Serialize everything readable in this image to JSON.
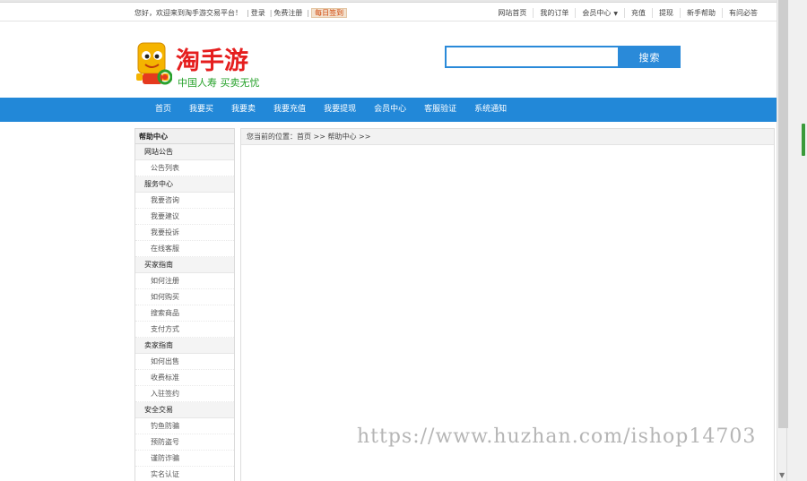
{
  "topbar": {
    "greeting": "您好，欢迎来到淘手游交易平台！",
    "login": "登录",
    "register": "免费注册",
    "signin": "每日签到",
    "links": [
      {
        "label": "网站首页",
        "style": ""
      },
      {
        "label": "我的订单",
        "style": ""
      },
      {
        "label": "会员中心",
        "style": "",
        "dropdown": true
      },
      {
        "label": "充值",
        "style": "orange"
      },
      {
        "label": "提现",
        "style": "green"
      },
      {
        "label": "新手帮助",
        "style": ""
      },
      {
        "label": "有问必答",
        "style": "red"
      }
    ]
  },
  "logo": {
    "name": "淘手游",
    "slogan": "中国人寿 买卖无忧"
  },
  "search": {
    "value": "",
    "placeholder": "",
    "button": "搜索"
  },
  "nav": [
    "首页",
    "我要买",
    "我要卖",
    "我要充值",
    "我要提现",
    "会员中心",
    "客服验证",
    "系统通知"
  ],
  "sidebar": {
    "title": "帮助中心",
    "groups": [
      {
        "name": "网站公告",
        "items": [
          "公告列表"
        ]
      },
      {
        "name": "服务中心",
        "items": [
          "我要咨询",
          "我要建议",
          "我要投诉",
          "在线客服"
        ]
      },
      {
        "name": "买家指南",
        "items": [
          "如何注册",
          "如何购买",
          "搜索商品",
          "支付方式"
        ]
      },
      {
        "name": "卖家指南",
        "items": [
          "如何出售",
          "收费标准",
          "入驻签约"
        ]
      },
      {
        "name": "安全交易",
        "items": [
          "钓鱼防骗",
          "预防盗号",
          "谨防诈骗",
          "实名认证"
        ]
      }
    ]
  },
  "breadcrumb": {
    "prefix": "您当前的位置：",
    "home": "首页",
    "sep": ">>",
    "current": "帮助中心",
    "trail": ">>"
  },
  "watermark": "https://www.huzhan.com/ishop14703",
  "colors": {
    "accent": "#2288d8",
    "logo_red": "#e51e1e",
    "slogan_green": "#27a22b"
  }
}
